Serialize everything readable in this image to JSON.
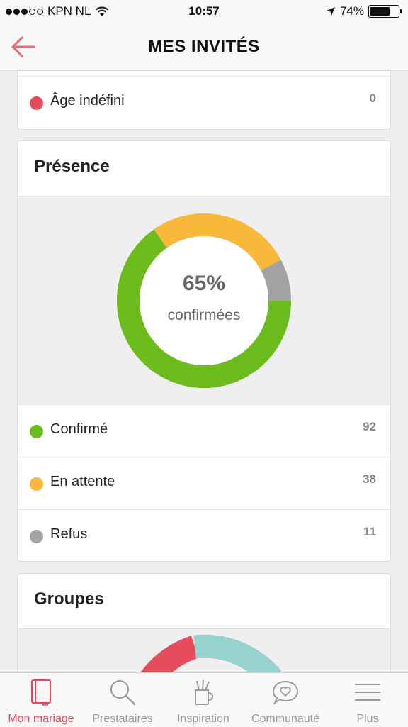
{
  "status_bar": {
    "carrier": "KPN NL",
    "time": "10:57",
    "battery": "74%",
    "battery_level": 0.74
  },
  "header": {
    "title": "MES INVITÉS",
    "back_icon": "arrow-left-icon"
  },
  "age_card": {
    "items": [
      {
        "label": "Âge indéfini",
        "count": "0",
        "color": "#e74c5c"
      }
    ]
  },
  "presence": {
    "title": "Présence",
    "center_value": "65%",
    "center_label": "confirmées",
    "items": [
      {
        "label": "Confirmé",
        "count": "92",
        "color": "#6cbc1e"
      },
      {
        "label": "En attente",
        "count": "38",
        "color": "#f8b93a"
      },
      {
        "label": "Refus",
        "count": "11",
        "color": "#a3a3a3"
      }
    ]
  },
  "chart_data": {
    "type": "pie",
    "categories": [
      "Confirmé",
      "En attente",
      "Refus"
    ],
    "values": [
      92,
      38,
      11
    ],
    "colors": [
      "#6cbc1e",
      "#f8b93a",
      "#a3a3a3"
    ],
    "donut": true
  },
  "groups": {
    "title": "Groupes",
    "partial_chart_colors": [
      "#e74c5c",
      "#96d2cf"
    ]
  },
  "tabbar": {
    "tabs": [
      {
        "label": "Mon mariage",
        "icon": "notebook-icon",
        "active": true
      },
      {
        "label": "Prestataires",
        "icon": "search-icon",
        "active": false
      },
      {
        "label": "Inspiration",
        "icon": "pencil-cup-icon",
        "active": false
      },
      {
        "label": "Communauté",
        "icon": "speech-bubble-heart-icon",
        "active": false
      },
      {
        "label": "Plus",
        "icon": "menu-icon",
        "active": false
      }
    ]
  }
}
